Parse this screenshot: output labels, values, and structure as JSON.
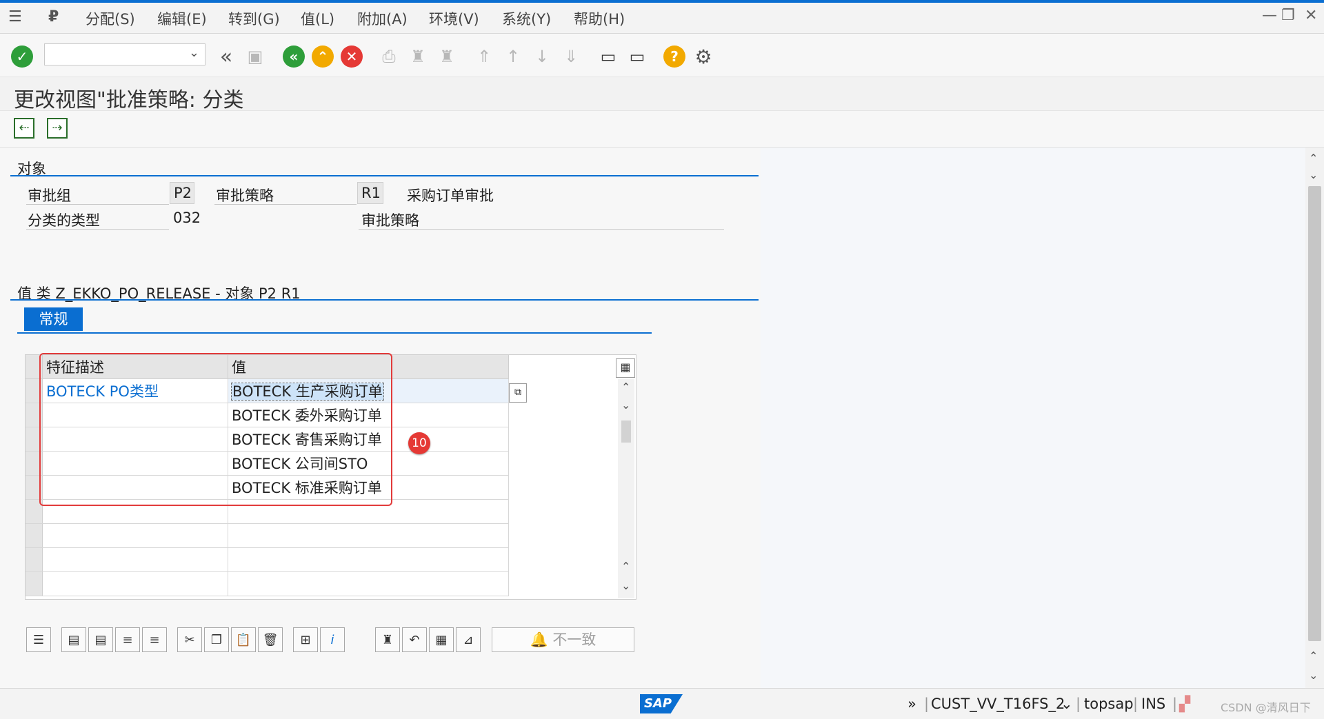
{
  "menu": {
    "items": [
      "分配(S)",
      "编辑(E)",
      "转到(G)",
      "值(L)",
      "附加(A)",
      "环境(V)",
      "系统(Y)",
      "帮助(H)"
    ]
  },
  "window": {
    "minimize": "—",
    "restore": "❐",
    "close": "✕"
  },
  "toolbar": {
    "command_value": "",
    "icons": [
      "check-icon",
      "back-icon",
      "exit-icon",
      "cancel-icon",
      "save-icon",
      "print-icon",
      "find-icon",
      "find-next-icon",
      "first-page-icon",
      "prev-page-icon",
      "next-page-icon",
      "last-page-icon",
      "new-session-icon",
      "shortcut-icon",
      "help-icon",
      "settings-icon"
    ]
  },
  "page": {
    "title": "更改视图\"批准策略: 分类"
  },
  "object_group": {
    "title": "对象",
    "approval_group_label": "审批组",
    "approval_group_value": "P2",
    "approval_strategy_label": "审批策略",
    "approval_strategy_value": "R1",
    "approval_strategy_desc": "采购订单审批",
    "class_type_label": "分类的类型",
    "class_type_value": "032",
    "strategy_label2": "审批策略"
  },
  "values_group": {
    "title": "值 类 Z_EKKO_PO_RELEASE - 对象 P2 R1",
    "tab_label": "常规"
  },
  "table": {
    "headers": [
      "特征描述",
      "值"
    ],
    "rows": [
      {
        "characteristic": "BOTECK PO类型",
        "value": "BOTECK 生产采购订单"
      },
      {
        "characteristic": "",
        "value": "BOTECK 委外采购订单"
      },
      {
        "characteristic": "",
        "value": "BOTECK 寄售采购订单"
      },
      {
        "characteristic": "",
        "value": "BOTECK 公司间STO"
      },
      {
        "characteristic": "",
        "value": "BOTECK 标准采购订单"
      },
      {
        "characteristic": "",
        "value": ""
      },
      {
        "characteristic": "",
        "value": ""
      },
      {
        "characteristic": "",
        "value": ""
      },
      {
        "characteristic": "",
        "value": ""
      }
    ]
  },
  "annotation": {
    "badge": "10"
  },
  "buttons": {
    "inconsistent_label": "不一致"
  },
  "status": {
    "logo": "SAP",
    "transaction": "CUST_VV_T16FS_2",
    "user": "topsap",
    "mode": "INS",
    "watermark": "CSDN @清风日下"
  },
  "colors": {
    "accent": "#0a6ed1",
    "highlight": "#e23b3b"
  }
}
